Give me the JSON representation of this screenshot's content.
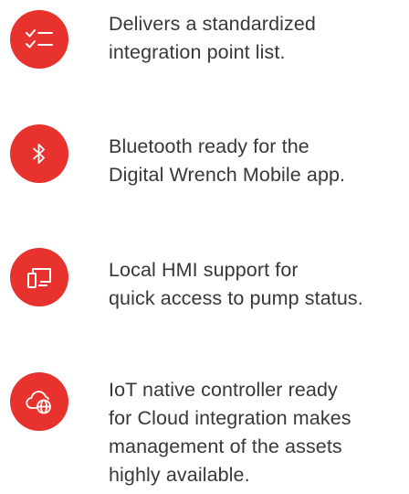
{
  "colors": {
    "accent": "#e8322e",
    "icon_foreground": "#ffffff",
    "text": "#383838"
  },
  "features": [
    {
      "icon": "checklist-icon",
      "lines": [
        "Delivers a standardized",
        "integration point list."
      ]
    },
    {
      "icon": "bluetooth-icon",
      "lines": [
        "Bluetooth ready for the",
        "Digital Wrench Mobile app."
      ]
    },
    {
      "icon": "monitor-icon",
      "lines": [
        "Local HMI support for",
        "quick access to pump status."
      ]
    },
    {
      "icon": "cloud-globe-icon",
      "lines": [
        "IoT native controller ready",
        "for Cloud integration makes",
        "management of the assets",
        "highly available."
      ]
    }
  ]
}
